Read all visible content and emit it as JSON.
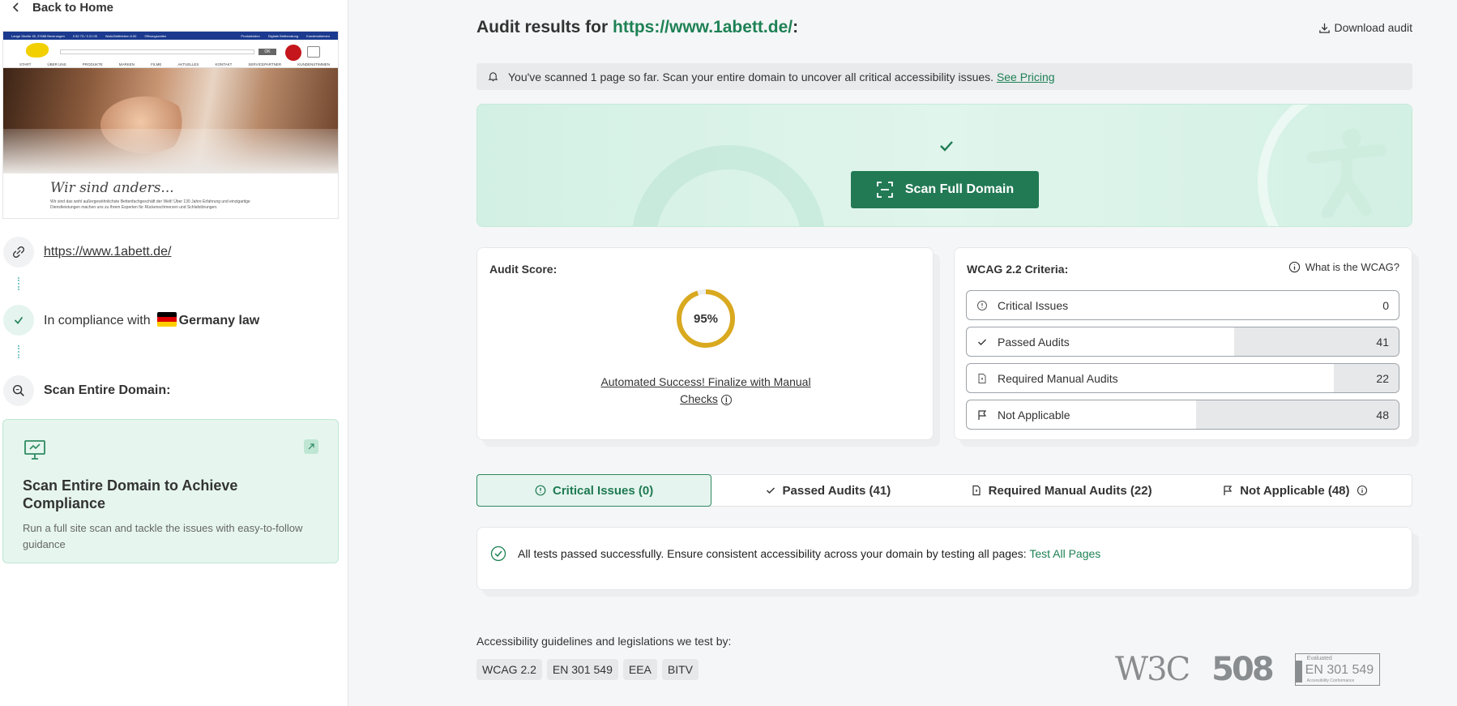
{
  "sidebar": {
    "back_label": "Back to Home",
    "thumbnail": {
      "top_info": [
        "Lange Straße 35, 37688 Beverungen",
        "0 52 73 / 3 21 05",
        "Wald-Bettfeldern 6.00",
        "Öffnungszeiten"
      ],
      "top_right": [
        "Produktvideo",
        "Digitale Bettberatung",
        "Kundenstimmen"
      ],
      "search_btn": "OK",
      "menu": [
        "START",
        "ÜBER UNS",
        "PRODUKTE",
        "MARKEN",
        "FILME",
        "AKTUELLES",
        "KONTAKT",
        "SERVICEPARTNER",
        "KUNDENSTIMMEN"
      ],
      "slogan": "Wir sind anders...",
      "text": "Wir sind das wohl außergewöhnlichste Bettenfachgeschäft der Welt! Über 130 Jahre Erfahrung und einzigartige Dienstleistungen machen uns zu Ihrem Experten für Rückenschmerzen und Schlafstörungen."
    },
    "url": "https://www.1abett.de/",
    "compliance_prefix": "In compliance with",
    "compliance_country": "Germany law",
    "scan_label": "Scan Entire Domain:",
    "promo": {
      "title": "Scan Entire Domain to Achieve Compliance",
      "desc": "Run a full site scan and tackle the issues with easy-to-follow guidance"
    }
  },
  "header": {
    "title_prefix": "Audit results for",
    "title_url": "https://www.1abett.de/",
    "title_suffix": ":",
    "download_label": "Download audit"
  },
  "notice": {
    "text": "You've scanned 1 page so far. Scan your entire domain to uncover all critical accessibility issues.",
    "link": "See Pricing"
  },
  "banner": {
    "button_label": "Scan Full Domain"
  },
  "score": {
    "title": "Audit Score:",
    "value_label": "95%",
    "value": 95,
    "message_line1": "Automated Success! Finalize with Manual",
    "message_line2": "Checks",
    "ring_color": "#d9a91f"
  },
  "wcag": {
    "title": "WCAG 2.2 Criteria:",
    "what_label": "What is the WCAG?",
    "rows": [
      {
        "label": "Critical Issues",
        "count": "0",
        "fraction": 0
      },
      {
        "label": "Passed Audits",
        "count": "41",
        "fraction": 0.38
      },
      {
        "label": "Required Manual Audits",
        "count": "22",
        "fraction": 0.15
      },
      {
        "label": "Not Applicable",
        "count": "48",
        "fraction": 0.47
      }
    ]
  },
  "tabs": [
    {
      "label": "Critical Issues (0)"
    },
    {
      "label": "Passed Audits (41)"
    },
    {
      "label": "Required Manual Audits (22)"
    },
    {
      "label": "Not Applicable (48)"
    }
  ],
  "result": {
    "text": "All tests passed successfully. Ensure consistent accessibility across your domain by testing all pages:",
    "link": "Test All Pages"
  },
  "footer": {
    "guide_label": "Accessibility guidelines and legislations we test by:",
    "badges": [
      "WCAG 2.2",
      "EN 301 549",
      "EEA",
      "BITV"
    ],
    "logo_w3c": "W3C",
    "logo_508": "508",
    "logo_en_eval": "Evaluated",
    "logo_en_code": "EN 301 549",
    "logo_en_sub": "Accessibility Conformance"
  },
  "colors": {
    "brand_green": "#1e8155",
    "button_green": "#227a55",
    "ring_gold": "#d9a91f"
  }
}
